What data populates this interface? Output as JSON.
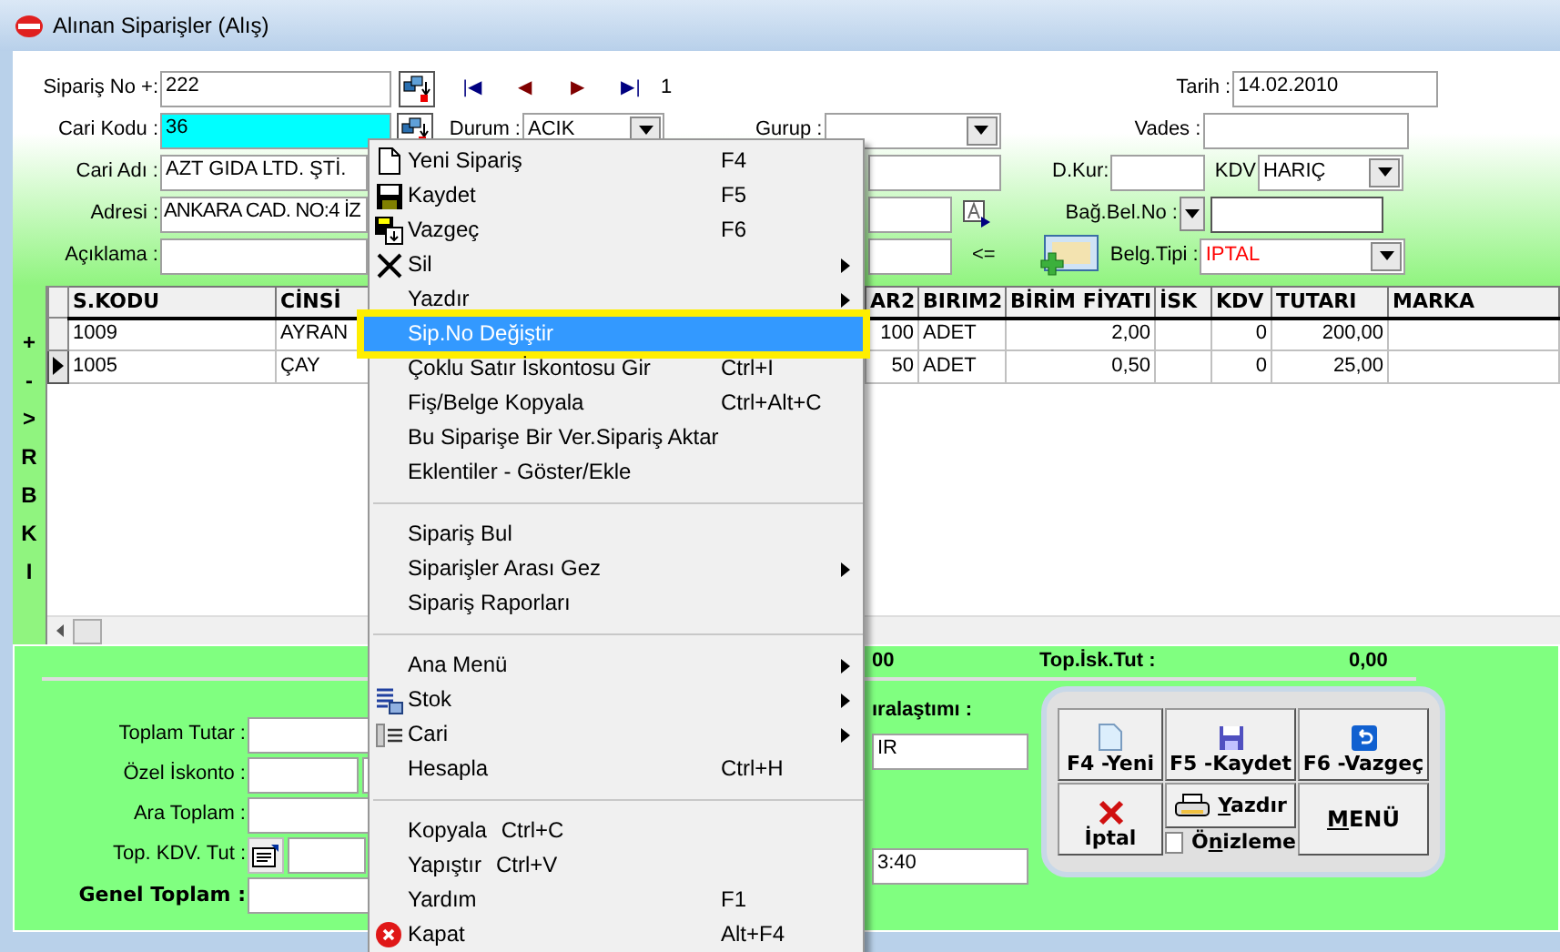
{
  "window": {
    "title": "Alınan Siparişler (Alış)"
  },
  "header": {
    "siparis_no": {
      "label": "Sipariş No +:",
      "value": "222"
    },
    "nav": [
      "|◀",
      "◀",
      "▶",
      "▶|"
    ],
    "record": "1",
    "cari_kodu": {
      "label": "Cari Kodu :",
      "value": "36"
    },
    "durum": {
      "label": "Durum :",
      "value": "ACIK"
    },
    "gurup": {
      "label": "Gurup :"
    },
    "cari_adi": {
      "label": "Cari Adı :",
      "value": "AZT GIDA LTD. ŞTİ."
    },
    "adresi": {
      "label": "Adresi :",
      "value": "ANKARA CAD. NO:4 İZ"
    },
    "aciklama": {
      "label": "Açıklama :"
    },
    "arrow_text": "<=",
    "tarih": {
      "label": "Tarih :",
      "value": "14.02.2010"
    },
    "vades": {
      "label": "Vades :"
    },
    "d_kur": {
      "label": "D.Kur:"
    },
    "kdv": {
      "label": "KDV",
      "value": "HARIÇ"
    },
    "bag_bel_no": {
      "label": "Bağ.Bel.No :"
    },
    "belg_tipi": {
      "label": "Belg.Tipi :",
      "value": "IPTAL"
    }
  },
  "side_buttons": [
    "+",
    "-",
    ">",
    "R",
    "B",
    "K",
    "I"
  ],
  "table": {
    "columns": [
      "S.KODU",
      "CİNSİ",
      "",
      "AR2",
      "BIRIM2",
      "BİRİM FİYATI",
      "İSK",
      "KDV",
      "TUTARI",
      "MARKA"
    ],
    "rows": [
      {
        "selected": false,
        "cells": [
          "1009",
          "AYRAN",
          "",
          "100",
          "ADET",
          "2,00",
          "",
          "0",
          "200,00",
          ""
        ]
      },
      {
        "selected": true,
        "cells": [
          "1005",
          "ÇAY",
          "",
          "50",
          "ADET",
          "0,50",
          "",
          "0",
          "25,00",
          ""
        ]
      }
    ]
  },
  "totals": {
    "cut_value": "00",
    "isk_label": "Top.İsk.Tut :",
    "isk_value": "0,00",
    "toplam_tutar": "Toplam Tutar :",
    "ozel_iskonto": "Özel İskonto :",
    "ara_toplam": "Ara Toplam :",
    "top_kdv": "Top. KDV. Tut :",
    "genel_toplam": "Genel Toplam :",
    "cut_label": "ıralaştımı :",
    "cut_field_1": "IR",
    "cut_field_2": "3:40"
  },
  "actions": {
    "yeni": "F4 -Yeni",
    "kaydet": "F5 -Kaydet",
    "vazgec": "F6 -Vazgeç",
    "iptal": "İptal",
    "yazdir": "Yazdır",
    "menu": "MENÜ",
    "onizleme": {
      "label": "Önizleme",
      "checked": false
    }
  },
  "context_menu": [
    {
      "kind": "plain",
      "label": "Yeni Sipariş",
      "shortcut": "F4",
      "submenu": false,
      "selected": false
    },
    {
      "kind": "plain",
      "label": "Kaydet",
      "shortcut": "F5",
      "submenu": false,
      "selected": false
    },
    {
      "kind": "plain",
      "label": "Vazgeç",
      "shortcut": "F6",
      "submenu": false,
      "selected": false
    },
    {
      "kind": "plain",
      "label": "Sil",
      "submenu": true,
      "selected": false
    },
    {
      "kind": "plain",
      "label": "Yazdır",
      "submenu": true,
      "selected": false
    },
    {
      "kind": "plain",
      "label": "Sip.No Değiştir",
      "submenu": false,
      "selected": true
    },
    {
      "kind": "plain",
      "label": "Çoklu Satır İskontosu Gir",
      "shortcut": "Ctrl+I",
      "submenu": false,
      "selected": false
    },
    {
      "kind": "plain",
      "label": "Fiş/Belge Kopyala",
      "shortcut": "Ctrl+Alt+C",
      "submenu": false,
      "selected": false
    },
    {
      "kind": "plain",
      "label": "Bu Siparişe Bir Ver.Sipariş Aktar",
      "submenu": false,
      "selected": false
    },
    {
      "kind": "plain",
      "label": "Eklentiler - Göster/Ekle",
      "submenu": false,
      "selected": false
    },
    {
      "kind": "separator"
    },
    {
      "kind": "plain",
      "label": "Sipariş Bul",
      "submenu": false,
      "selected": false
    },
    {
      "kind": "plain",
      "label": "Siparişler Arası Gez",
      "submenu": true,
      "selected": false
    },
    {
      "kind": "plain",
      "label": "Sipariş Raporları",
      "submenu": false,
      "selected": false
    },
    {
      "kind": "separator"
    },
    {
      "kind": "plain",
      "label": "Ana Menü",
      "submenu": true,
      "selected": false
    },
    {
      "kind": "plain",
      "label": "Stok",
      "submenu": true,
      "selected": false
    },
    {
      "kind": "plain",
      "label": "Cari",
      "submenu": true,
      "selected": false
    },
    {
      "kind": "plain",
      "label": "Hesapla",
      "shortcut": "Ctrl+H",
      "submenu": false,
      "selected": false
    },
    {
      "kind": "separator"
    },
    {
      "kind": "compact",
      "label": "Kopyala",
      "shortcut": "Ctrl+C",
      "submenu": false,
      "selected": false
    },
    {
      "kind": "compact",
      "label": "Yapıştır",
      "shortcut": "Ctrl+V",
      "submenu": false,
      "selected": false
    },
    {
      "kind": "plain",
      "label": "Yardım",
      "shortcut": "F1",
      "submenu": false,
      "selected": false
    },
    {
      "kind": "plain",
      "label": "Kapat",
      "shortcut": "Alt+F4",
      "submenu": false,
      "selected": false
    }
  ]
}
